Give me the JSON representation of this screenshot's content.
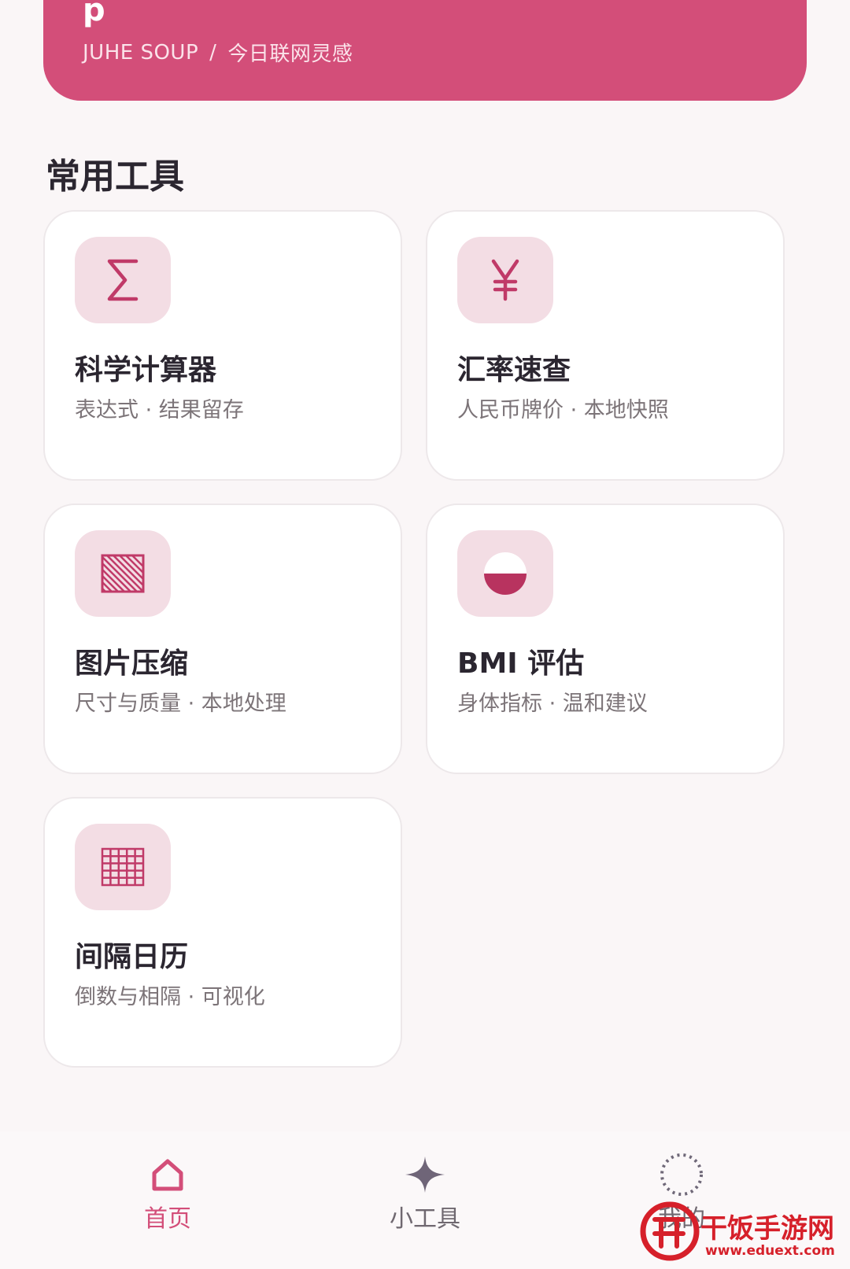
{
  "header": {
    "title": "p",
    "breadcrumb": {
      "en": "JUHE SOUP",
      "sep": "/",
      "cn": "今日联网灵感"
    }
  },
  "section": {
    "title": "常用工具"
  },
  "tools": [
    {
      "title": "科学计算器",
      "subtitle": "表达式 · 结果留存",
      "icon": "sigma-icon"
    },
    {
      "title": "汇率速查",
      "subtitle": "人民币牌价 · 本地快照",
      "icon": "yen-icon"
    },
    {
      "title": "图片压缩",
      "subtitle": "尺寸与质量 · 本地处理",
      "icon": "hatched-square-icon"
    },
    {
      "title": "BMI 评估",
      "subtitle": "身体指标 · 温和建议",
      "icon": "half-circle-icon"
    },
    {
      "title": "间隔日历",
      "subtitle": "倒数与相隔 · 可视化",
      "icon": "grid-calendar-icon"
    }
  ],
  "nav": {
    "items": [
      {
        "label": "首页",
        "icon": "home-icon",
        "active": true
      },
      {
        "label": "小工具",
        "icon": "sparkle-icon",
        "active": false
      },
      {
        "label": "我的",
        "icon": "profile-icon",
        "active": false
      }
    ]
  },
  "watermark": {
    "text": "干饭手游网",
    "url": "www.eduext.com"
  },
  "colors": {
    "accent": "#d34e79",
    "icon_tile": "#f3dde4",
    "text_primary": "#2b2630",
    "text_secondary": "#7c7478",
    "background": "#faf6f7"
  }
}
